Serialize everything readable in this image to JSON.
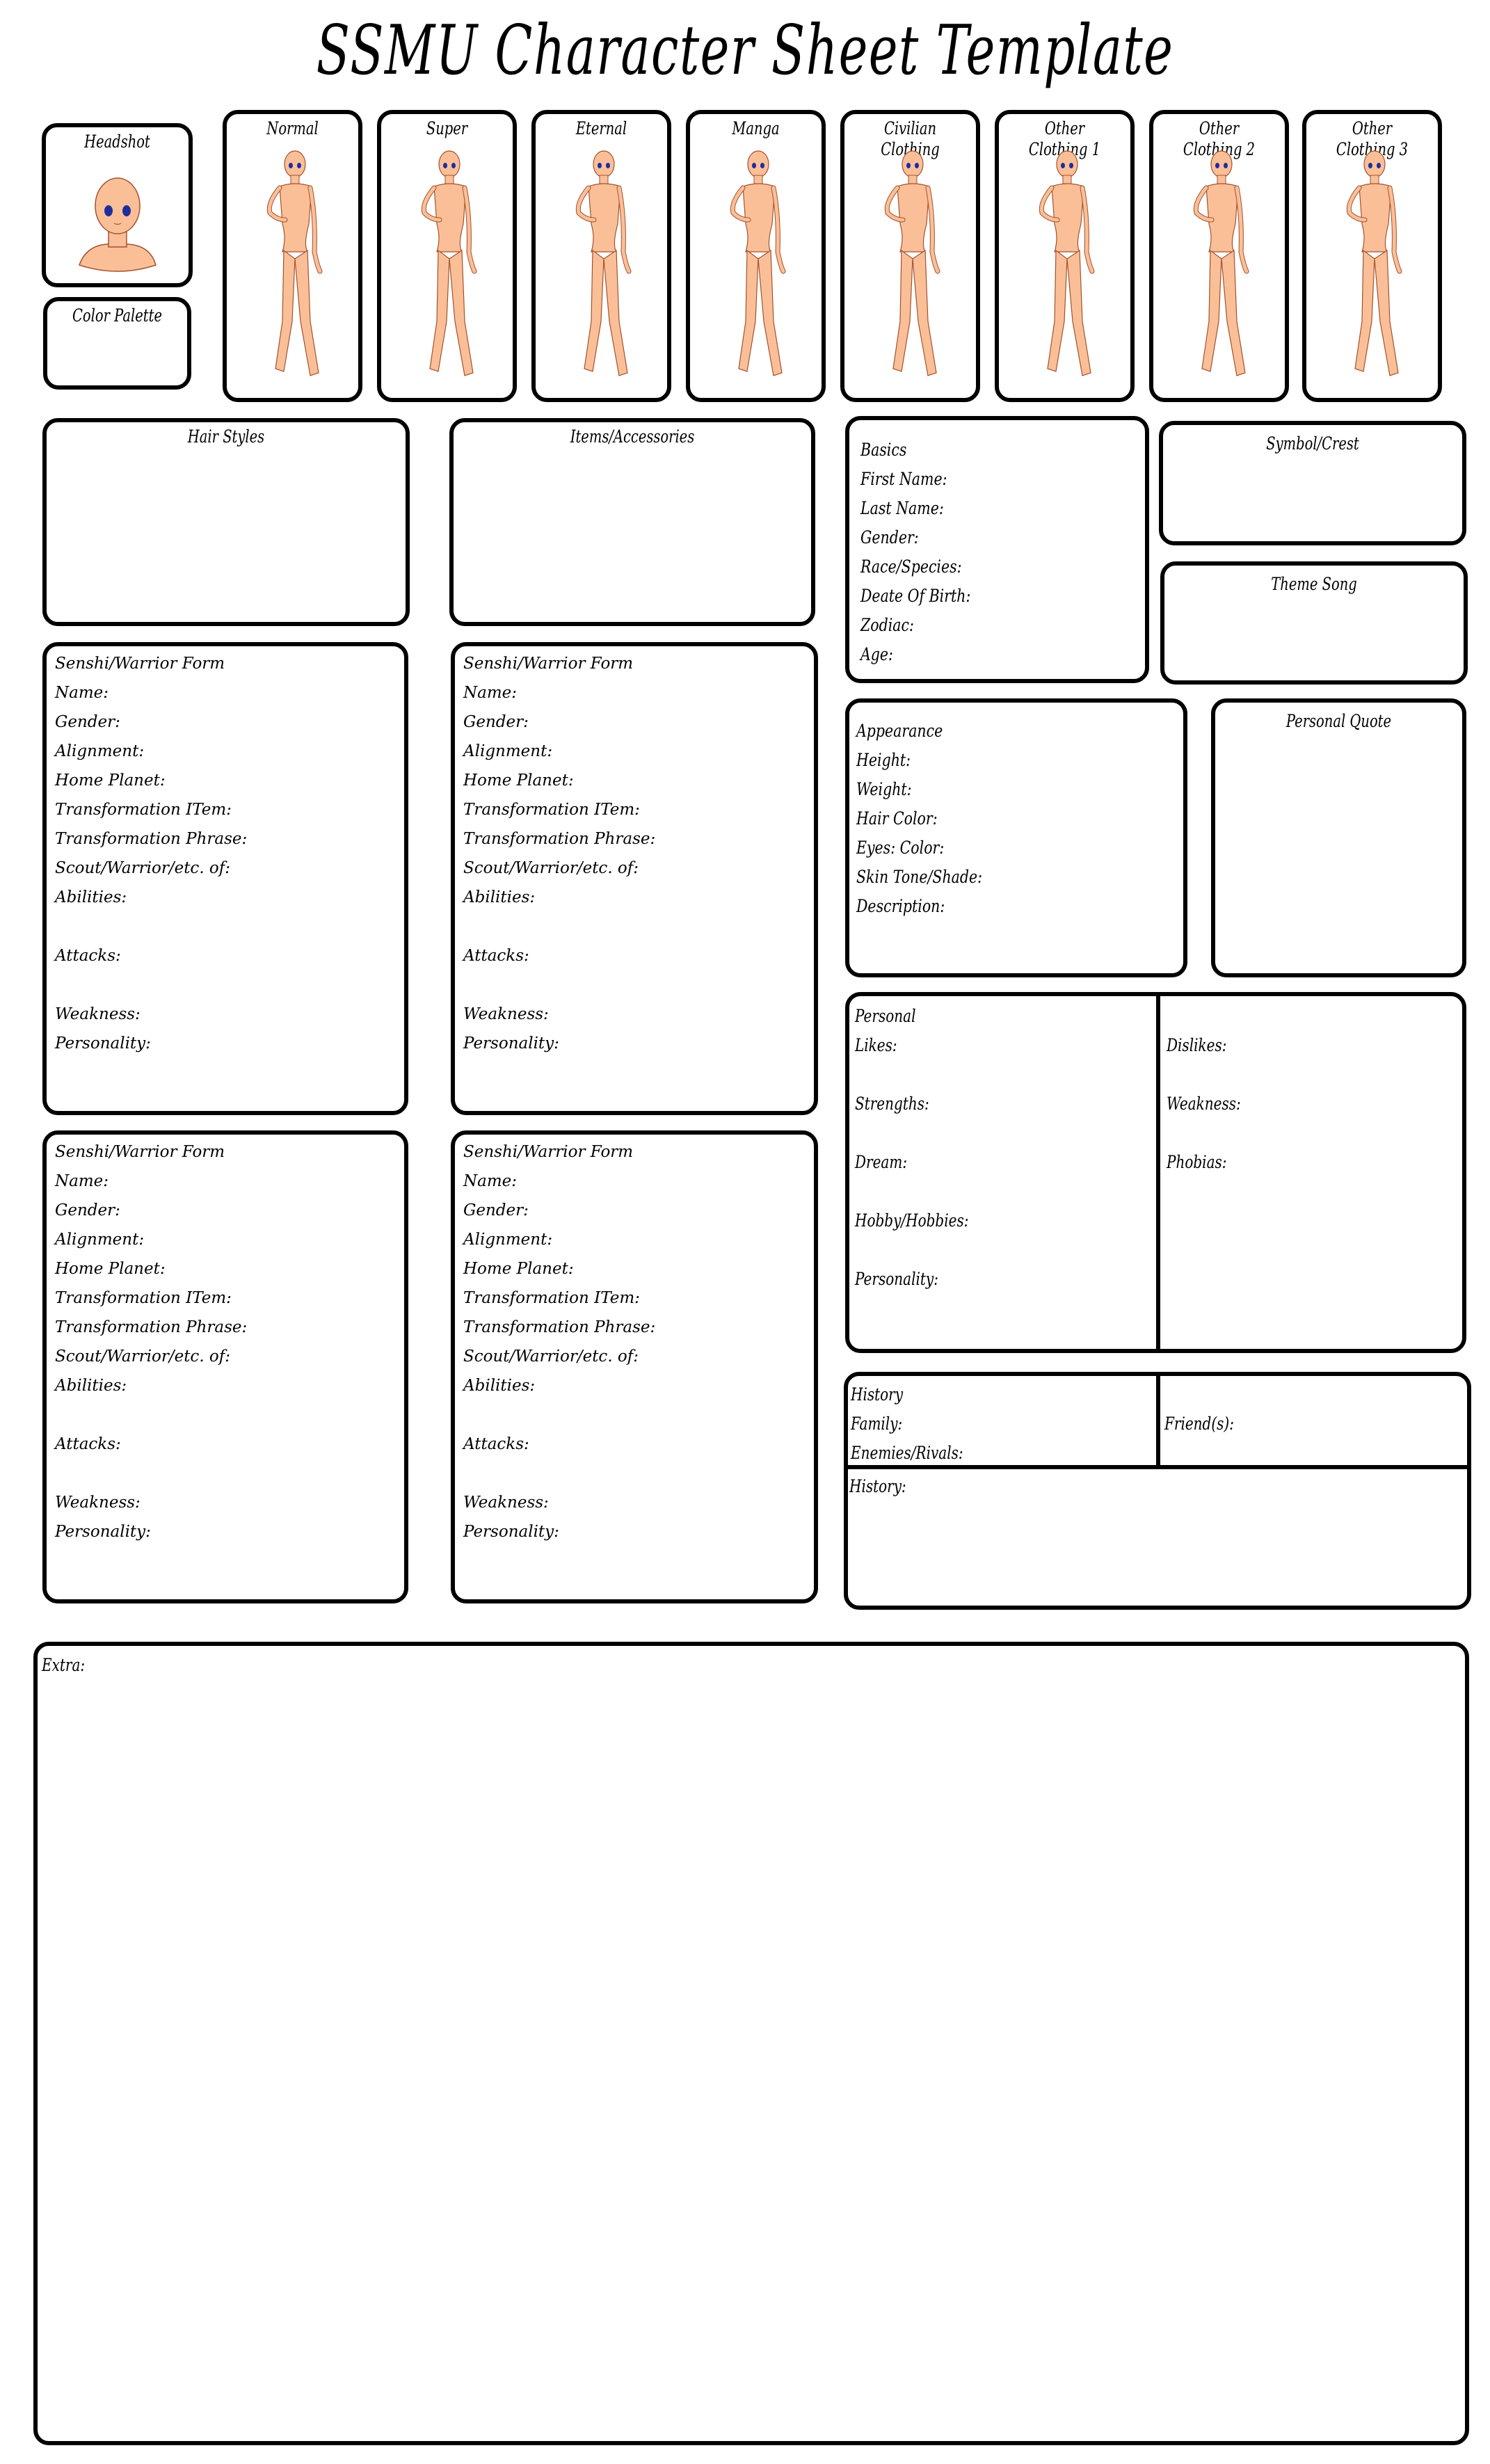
{
  "title": "SSMU Character Sheet Template",
  "headshot": {
    "label": "Headshot",
    "image": "bald-anime-headshot-base"
  },
  "color_palette": {
    "label": "Color Palette"
  },
  "figures": [
    {
      "label": "Normal",
      "image": "anime-body-base"
    },
    {
      "label": "Super",
      "image": "anime-body-base"
    },
    {
      "label": "Eternal",
      "image": "anime-body-base"
    },
    {
      "label": "Manga",
      "image": "anime-body-base"
    },
    {
      "label": "Civilian Clothing",
      "image": "anime-body-base"
    },
    {
      "label": "Other Clothing 1",
      "image": "anime-body-base"
    },
    {
      "label": "Other Clothing 2",
      "image": "anime-body-base"
    },
    {
      "label": "Other Clothing 3",
      "image": "anime-body-base"
    }
  ],
  "hair_styles": {
    "label": "Hair Styles"
  },
  "items_accessories": {
    "label": "Items/Accessories"
  },
  "basics": {
    "heading": "Basics",
    "fields": [
      "First Name:",
      "Last Name:",
      "Gender:",
      "Race/Species:",
      "Deate Of Birth:",
      "Zodiac:",
      "Age:"
    ]
  },
  "symbol_crest": {
    "label": "Symbol/Crest"
  },
  "theme_song": {
    "label": "Theme Song"
  },
  "senshi_forms": [
    {
      "heading": "Senshi/Warrior Form"
    },
    {
      "heading": "Senshi/Warrior Form"
    },
    {
      "heading": "Senshi/Warrior Form"
    },
    {
      "heading": "Senshi/Warrior Form"
    }
  ],
  "senshi_fields": {
    "name": "Name:",
    "gender": "Gender:",
    "alignment": "Alignment:",
    "home_planet": "Home Planet:",
    "transformation_item": "Transformation ITem:",
    "transformation_phrase": "Transformation Phrase:",
    "scout_of": "Scout/Warrior/etc. of:",
    "abilities": "Abilities:",
    "attacks": "Attacks:",
    "weakness": "Weakness:",
    "personality": "Personality:"
  },
  "appearance": {
    "heading": "Appearance",
    "fields": [
      "Height:",
      "Weight:",
      "Hair Color:",
      "Eyes: Color:",
      "Skin Tone/Shade:",
      "Description:"
    ]
  },
  "personal_quote": {
    "label": "Personal Quote"
  },
  "personal": {
    "heading": "Personal",
    "left": [
      "Likes:",
      "Strengths:",
      "Dream:",
      "Hobby/Hobbies:",
      "Personality:"
    ],
    "right": [
      "Dislikes:",
      "Weakness:",
      "Phobias:"
    ]
  },
  "history": {
    "heading": "History",
    "family": "Family:",
    "enemies": "Enemies/Rivals:",
    "friends": "Friend(s):",
    "history_label": "History:"
  },
  "extra": {
    "label": "Extra:"
  },
  "colors": {
    "line": "#000000",
    "skin": "#FBBF98",
    "skin_outline": "#A0522D",
    "eye": "#1E2E9E"
  }
}
